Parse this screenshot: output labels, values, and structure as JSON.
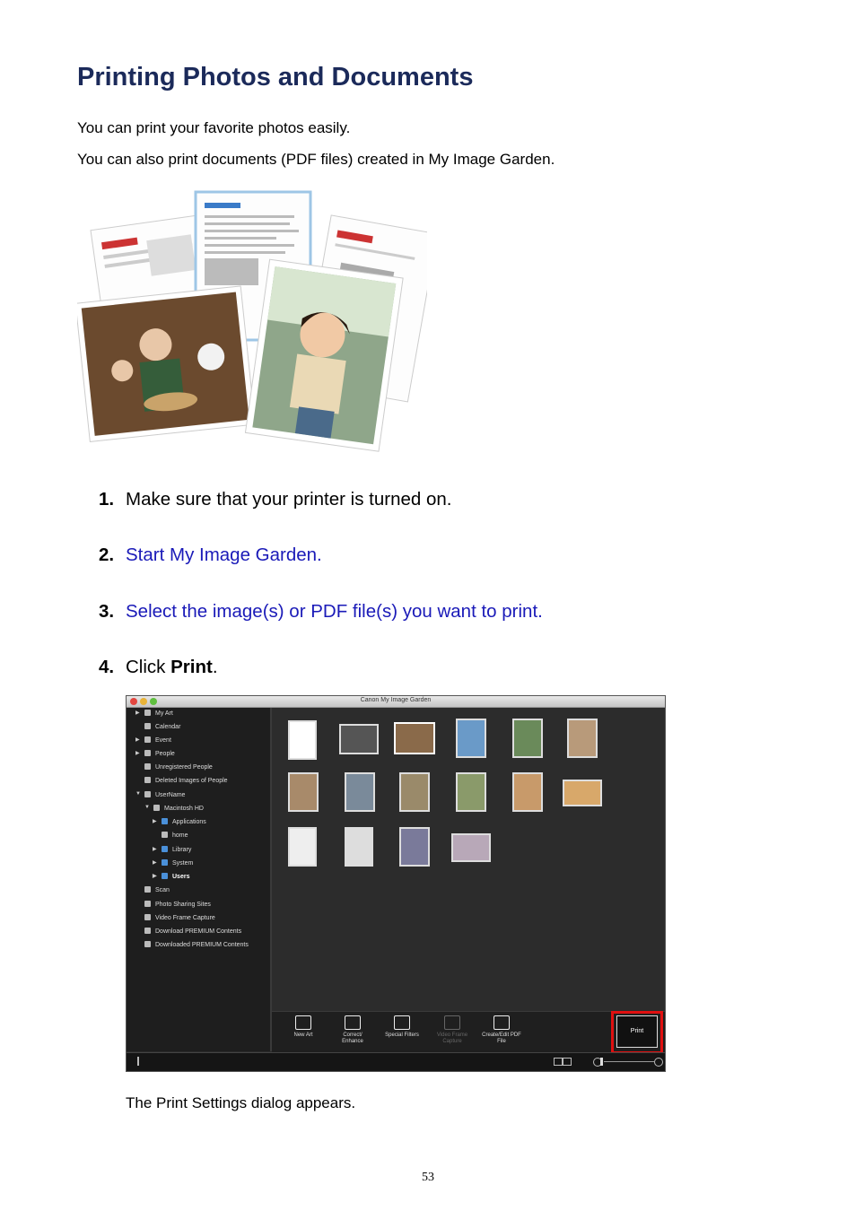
{
  "title": "Printing Photos and Documents",
  "intro": [
    "You can print your favorite photos easily.",
    "You can also print documents (PDF files) created in My Image Garden."
  ],
  "steps": [
    {
      "num": "1.",
      "text": "Make sure that your printer is turned on."
    },
    {
      "num": "2.",
      "text": "Start My Image Garden."
    },
    {
      "num": "3.",
      "text": "Select the image(s) or PDF file(s) you want to print."
    },
    {
      "num": "4.",
      "text_before": "Click ",
      "bold": "Print",
      "text_after": "."
    }
  ],
  "app": {
    "window_title": "Canon My Image Garden",
    "sidebar_items": [
      "My Art",
      "Calendar",
      "Event",
      "People",
      "Unregistered People",
      "Deleted Images of People",
      "UserName",
      "Macintosh HD",
      "Applications",
      "home",
      "Library",
      "System",
      "Users",
      "Scan",
      "Photo Sharing Sites",
      "Video Frame Capture",
      "Download PREMIUM Contents",
      "Downloaded PREMIUM Contents"
    ],
    "toolbar": {
      "new_art": "New Art",
      "correct": "Correct/ Enhance",
      "special": "Special Filters",
      "video": "Video Frame Capture",
      "pdf": "Create/Edit PDF File",
      "print": "Print"
    }
  },
  "note": "The Print Settings dialog appears.",
  "page_number": "53"
}
